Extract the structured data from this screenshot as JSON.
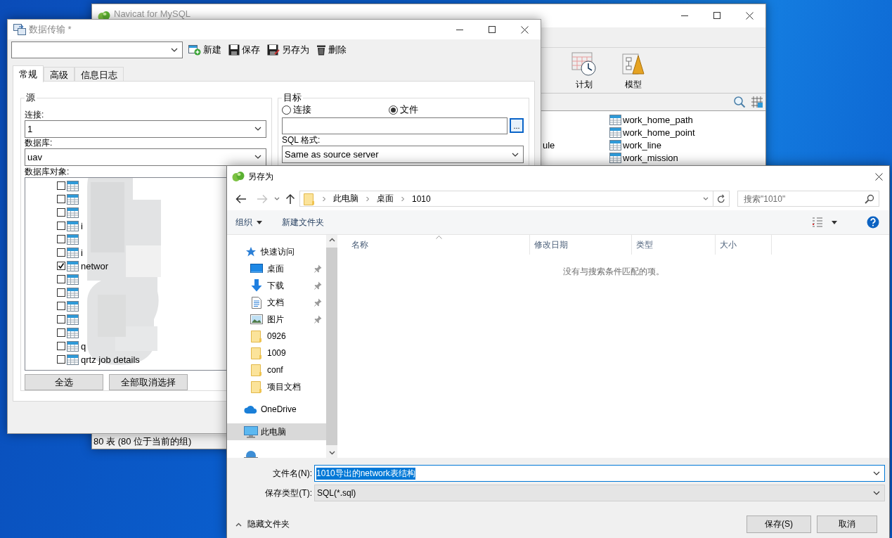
{
  "navicat_window": {
    "title": "Navicat for MySQL",
    "toolbar": [
      {
        "kind": "schedule",
        "label": "计划"
      },
      {
        "kind": "model",
        "label": "模型"
      }
    ],
    "object_list": {
      "column_1": [
        "ule"
      ],
      "column_2": [
        "work_home_path",
        "work_home_point",
        "work_line",
        "work_mission"
      ]
    },
    "status_bar": "80 表 (80 位于当前的组)"
  },
  "transfer_window": {
    "title": "数据传输 *",
    "toolbar": [
      {
        "kind": "new",
        "label": "新建"
      },
      {
        "kind": "save",
        "label": "保存"
      },
      {
        "kind": "save_as",
        "label": "另存为"
      },
      {
        "kind": "delete",
        "label": "删除"
      }
    ],
    "tabs": [
      {
        "label": "常规",
        "selected": true
      },
      {
        "label": "高级",
        "selected": false
      },
      {
        "label": "信息日志",
        "selected": false
      }
    ],
    "source": {
      "title": "源",
      "connection_label": "连接:",
      "connection": "1",
      "database_label": "数据库:",
      "database": "uav",
      "objects_label": "数据库对象:",
      "objects": [
        {
          "checked": false
        },
        {
          "checked": false
        },
        {
          "checked": false
        },
        {
          "name": "i",
          "checked": false
        },
        {
          "checked": false
        },
        {
          "name": "i",
          "checked": false
        },
        {
          "name": "networ",
          "checked": true
        },
        {
          "checked": false
        },
        {
          "checked": false
        },
        {
          "checked": false
        },
        {
          "checked": false
        },
        {
          "checked": false
        },
        {
          "name": "q",
          "checked": false
        },
        {
          "name": "qrtz job details",
          "checked": false
        }
      ],
      "buttons": [
        "全选",
        "全部取消选择"
      ]
    },
    "target": {
      "title": "目标",
      "options": [
        {
          "label": "连接",
          "selected": false
        },
        {
          "label": "文件",
          "selected": true
        }
      ],
      "browse_button": "...",
      "format_label": "SQL 格式:",
      "format": "Same as source server"
    }
  },
  "save_dialog": {
    "title": "另存为",
    "breadcrumb": [
      "此电脑",
      "桌面",
      "1010"
    ],
    "search": {
      "placeholder": "搜索\"1010\""
    },
    "toolbar": [
      "组织",
      "新建文件夹"
    ],
    "nav_pane": [
      {
        "kind": "quick_access",
        "label": "快速访问",
        "selected": false,
        "children": [
          {
            "kind": "desktop",
            "label": "桌面",
            "pinned": true,
            "selected": false
          },
          {
            "kind": "download",
            "label": "下载",
            "pinned": true,
            "selected": false
          },
          {
            "kind": "document",
            "label": "文档",
            "pinned": true,
            "selected": false
          },
          {
            "kind": "picture",
            "label": "图片",
            "pinned": true,
            "selected": false
          },
          {
            "kind": "folder",
            "label": "0926",
            "pinned": false,
            "selected": false
          },
          {
            "kind": "folder",
            "label": "1009",
            "pinned": false,
            "selected": false
          },
          {
            "kind": "folder",
            "label": "conf",
            "pinned": false,
            "selected": false
          },
          {
            "kind": "folder",
            "label": "项目文档",
            "pinned": false,
            "selected": false
          }
        ]
      },
      {
        "kind": "cloud",
        "label": "OneDrive",
        "selected": false
      },
      {
        "kind": "computer",
        "label": "此电脑",
        "selected": true
      },
      {
        "kind": "network",
        "selected": false
      }
    ],
    "columns": [
      "名称",
      "修改日期",
      "类型",
      "大小"
    ],
    "empty_message": "没有与搜索条件匹配的项。",
    "file_name_label": "文件名(N):",
    "file_name": "1010导出的network表结构",
    "file_name_selected": true,
    "file_type_label": "保存类型(T):",
    "file_type": "SQL(*.sql)",
    "hide_folders": "隐藏文件夹",
    "buttons": [
      "保存(S)",
      "取消"
    ]
  }
}
